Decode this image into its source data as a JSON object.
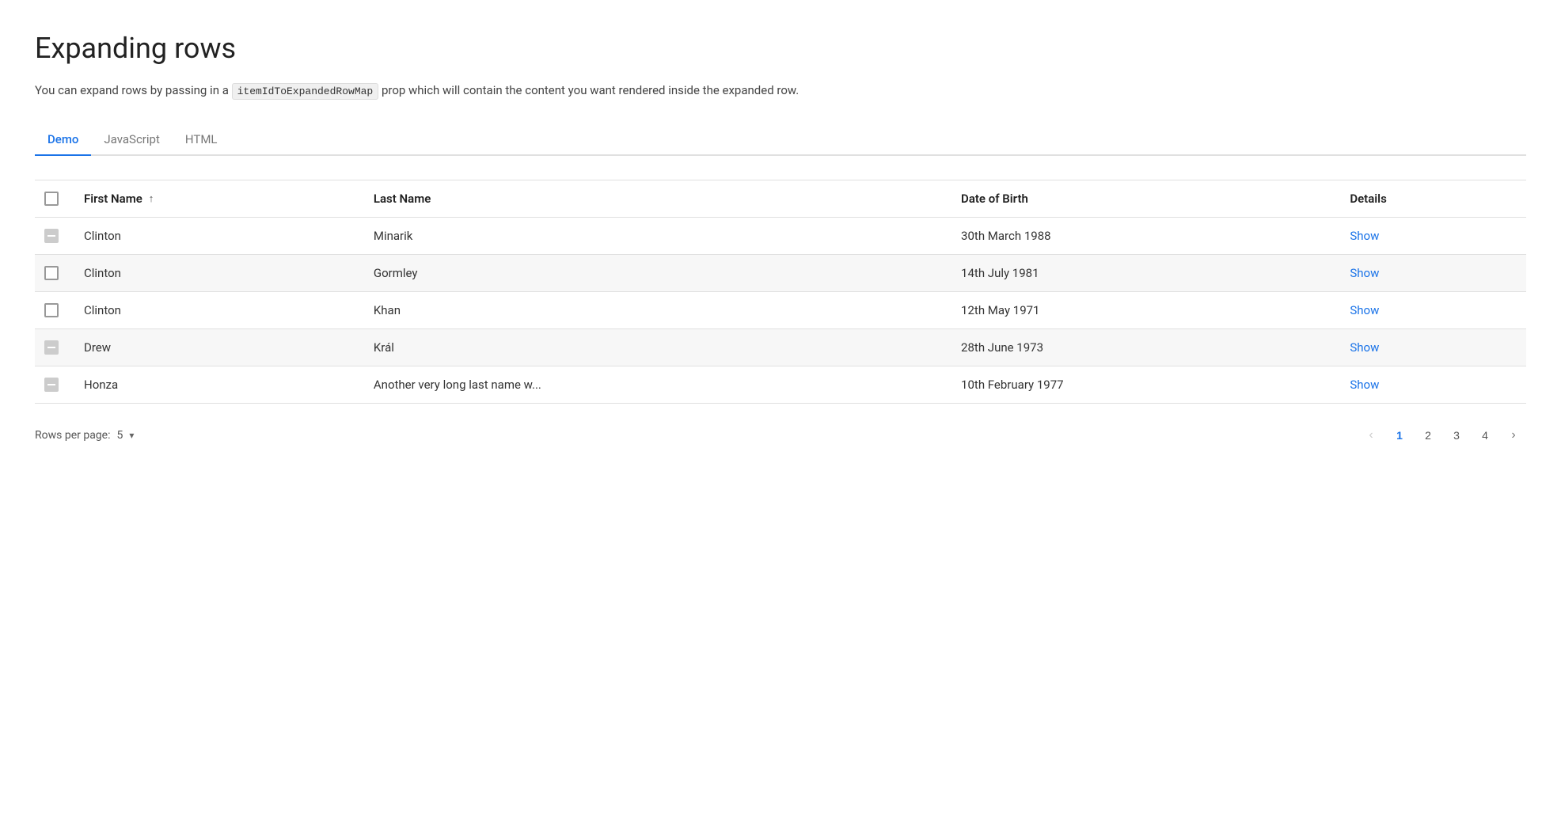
{
  "page": {
    "title": "Expanding rows",
    "description_part1": "You can expand rows by passing in a ",
    "description_code": "itemIdToExpandedRowMap",
    "description_part2": " prop which will contain the content you want rendered inside the expanded row."
  },
  "tabs": [
    {
      "id": "demo",
      "label": "Demo",
      "active": true
    },
    {
      "id": "javascript",
      "label": "JavaScript",
      "active": false
    },
    {
      "id": "html",
      "label": "HTML",
      "active": false
    }
  ],
  "table": {
    "columns": [
      {
        "id": "checkbox",
        "label": ""
      },
      {
        "id": "firstName",
        "label": "First Name",
        "sortable": true,
        "sortDirection": "asc"
      },
      {
        "id": "lastName",
        "label": "Last Name"
      },
      {
        "id": "dateOfBirth",
        "label": "Date of Birth"
      },
      {
        "id": "details",
        "label": "Details"
      }
    ],
    "rows": [
      {
        "id": 1,
        "firstName": "Clinton",
        "lastName": "Minarik",
        "dateOfBirth": "30th March 1988",
        "details": "Show",
        "checkState": "indeterminate"
      },
      {
        "id": 2,
        "firstName": "Clinton",
        "lastName": "Gormley",
        "dateOfBirth": "14th July 1981",
        "details": "Show",
        "checkState": "normal"
      },
      {
        "id": 3,
        "firstName": "Clinton",
        "lastName": "Khan",
        "dateOfBirth": "12th May 1971",
        "details": "Show",
        "checkState": "normal"
      },
      {
        "id": 4,
        "firstName": "Drew",
        "lastName": "Král",
        "dateOfBirth": "28th June 1973",
        "details": "Show",
        "checkState": "indeterminate"
      },
      {
        "id": 5,
        "firstName": "Honza",
        "lastName": "Another very long last name w...",
        "dateOfBirth": "10th February 1977",
        "details": "Show",
        "checkState": "indeterminate"
      }
    ]
  },
  "footer": {
    "rowsPerPage": "Rows per page:",
    "rowsPerPageValue": "5",
    "pagination": {
      "prevLabel": "‹",
      "nextLabel": "›",
      "pages": [
        "1",
        "2",
        "3",
        "4"
      ],
      "currentPage": "1"
    }
  }
}
